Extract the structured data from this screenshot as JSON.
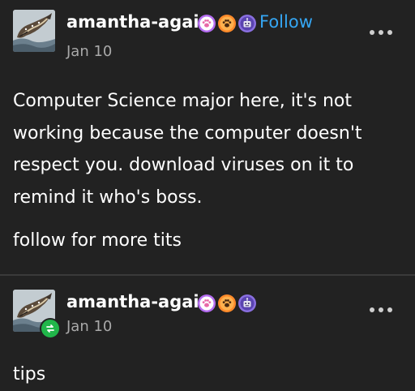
{
  "posts": [
    {
      "username": "amantha-again",
      "follow_label": "Follow",
      "date": "Jan 10",
      "paragraphs": [
        "Computer Science major here, it's not working because the computer doesn't respect you. download viruses on it to remind it who's boss.",
        "follow for more tits"
      ],
      "badge_icons": [
        "purple-paw-badge-icon",
        "orange-paw-badge-icon",
        "robot-badge-icon"
      ]
    },
    {
      "username": "amantha-again",
      "date": "Jan 10",
      "reblogged": true,
      "paragraphs": [
        "tips"
      ],
      "badge_icons": [
        "purple-paw-badge-icon",
        "orange-paw-badge-icon",
        "robot-badge-icon"
      ]
    }
  ],
  "colors": {
    "background": "#222222",
    "text": "#ffffff",
    "secondary_text": "#a9a9a9",
    "follow": "#35a6f3",
    "reblog": "#21b64a",
    "divider": "#3a3a3a"
  }
}
